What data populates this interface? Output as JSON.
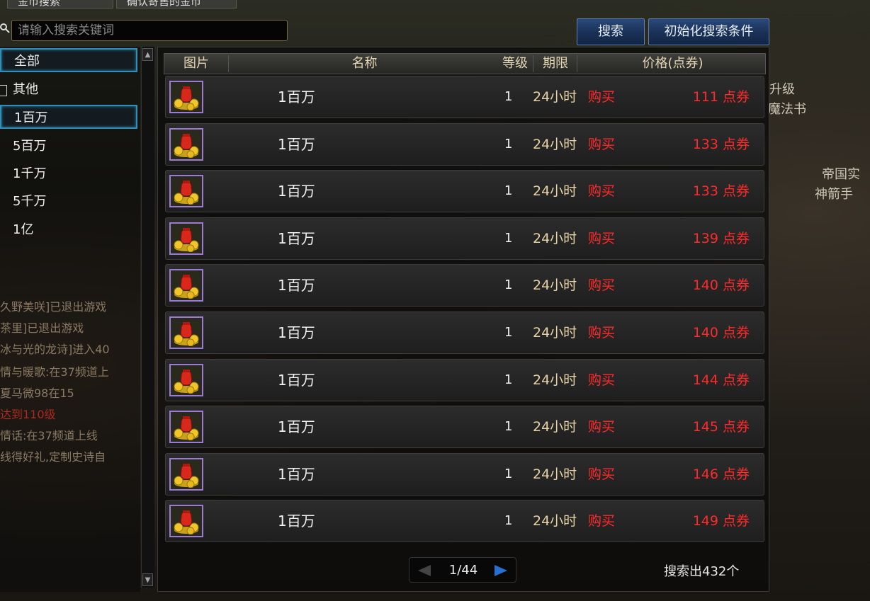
{
  "top": {
    "tab1": "金币搜索",
    "tab2": "确认寄售的金币"
  },
  "search": {
    "placeholder": "请输入搜索关键词",
    "search_label": "搜索",
    "reset_label": "初始化搜索条件"
  },
  "categories": [
    {
      "label": "全部"
    },
    {
      "label": "其他"
    },
    {
      "label": "1百万"
    },
    {
      "label": "5百万"
    },
    {
      "label": "1千万"
    },
    {
      "label": "5千万"
    },
    {
      "label": "1亿"
    }
  ],
  "table": {
    "headers": {
      "image": "图片",
      "name": "名称",
      "level": "等级",
      "period": "期限",
      "price": "价格(点券)"
    },
    "rows": [
      {
        "name": "1百万",
        "level": "1",
        "period": "24小时",
        "buy": "购买",
        "price": "111",
        "unit": "点券"
      },
      {
        "name": "1百万",
        "level": "1",
        "period": "24小时",
        "buy": "购买",
        "price": "133",
        "unit": "点券"
      },
      {
        "name": "1百万",
        "level": "1",
        "period": "24小时",
        "buy": "购买",
        "price": "133",
        "unit": "点券"
      },
      {
        "name": "1百万",
        "level": "1",
        "period": "24小时",
        "buy": "购买",
        "price": "139",
        "unit": "点券"
      },
      {
        "name": "1百万",
        "level": "1",
        "period": "24小时",
        "buy": "购买",
        "price": "140",
        "unit": "点券"
      },
      {
        "name": "1百万",
        "level": "1",
        "period": "24小时",
        "buy": "购买",
        "price": "140",
        "unit": "点券"
      },
      {
        "name": "1百万",
        "level": "1",
        "period": "24小时",
        "buy": "购买",
        "price": "144",
        "unit": "点券"
      },
      {
        "name": "1百万",
        "level": "1",
        "period": "24小时",
        "buy": "购买",
        "price": "145",
        "unit": "点券"
      },
      {
        "name": "1百万",
        "level": "1",
        "period": "24小时",
        "buy": "购买",
        "price": "146",
        "unit": "点券"
      },
      {
        "name": "1百万",
        "level": "1",
        "period": "24小时",
        "buy": "购买",
        "price": "149",
        "unit": "点券"
      }
    ]
  },
  "pagination": {
    "text": "1/44"
  },
  "result_count": "搜索出432个",
  "background_chat": [
    {
      "text": "久野美咲]已退出游戏",
      "red": false
    },
    {
      "text": "茶里]已退出游戏",
      "red": false
    },
    {
      "text": "冰与光的龙诗]进入40",
      "red": false
    },
    {
      "text": "情与暖歌:在37频道上",
      "red": false
    },
    {
      "text": "夏马微98在15",
      "red": false
    },
    {
      "text": "达到110级",
      "red": true
    },
    {
      "text": "情话:在37频道上线",
      "red": false
    },
    {
      "text": "线得好礼,定制史诗自",
      "red": false
    }
  ],
  "background_right": {
    "line1": "升级",
    "line2": "魔法书",
    "line3": "帝国实",
    "line4": "神箭手"
  },
  "colors": {
    "accent_blue": "#2f8fb8",
    "price_red": "#ff2a2a",
    "period_tan": "#e8d2a4"
  },
  "icons": {
    "search": "magnifier-icon",
    "item": "gold-coin-bag-icon",
    "prev": "left-arrow-icon",
    "next": "right-arrow-icon"
  }
}
